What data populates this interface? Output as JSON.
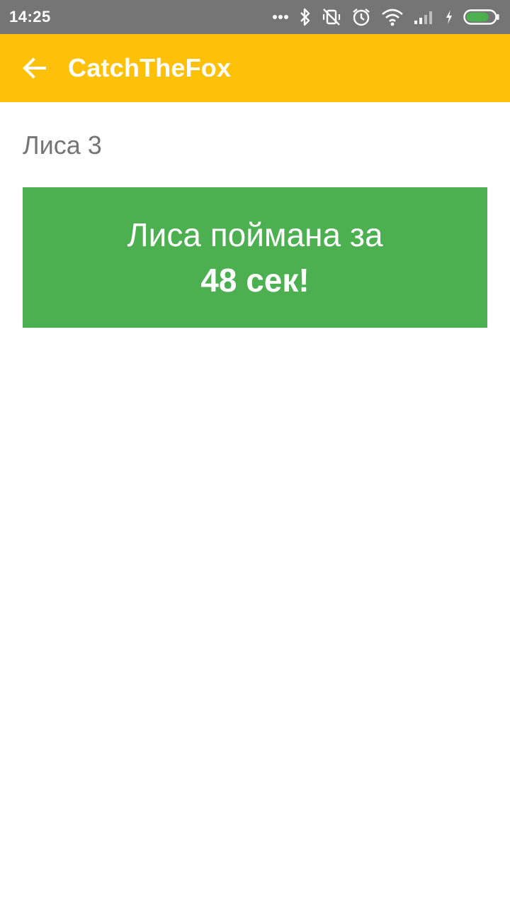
{
  "status_bar": {
    "time": "14:25",
    "icons": [
      "more-dots-icon",
      "bluetooth-icon",
      "vibrate-off-icon",
      "alarm-icon",
      "wifi-icon",
      "signal-icon",
      "charging-icon",
      "battery-icon"
    ],
    "battery_level": 0.8,
    "battery_color": "#4CAF50"
  },
  "app_bar": {
    "title": "CatchTheFox",
    "back_icon": "arrow-back-icon",
    "color": "#FFC107"
  },
  "main": {
    "fox_label": "Лиса 3",
    "result": {
      "line1": "Лиса поймана за",
      "line2": "48 сек!",
      "color": "#4CAF50"
    }
  }
}
